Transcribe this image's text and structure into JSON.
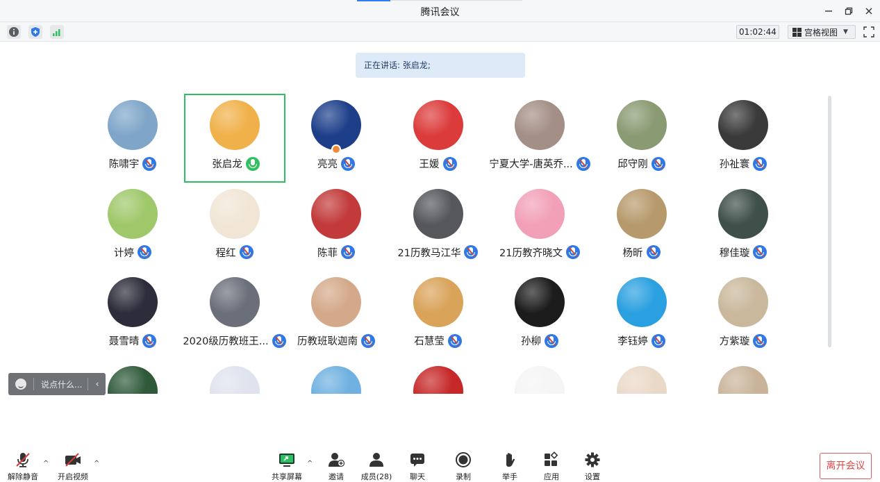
{
  "window": {
    "title": "腾讯会议",
    "icons": [
      "info-icon",
      "shield-icon",
      "signal-icon"
    ],
    "timer": "01:02:44",
    "view_mode": "宫格视图",
    "speaking_banner": "正在讲话: 张启龙;"
  },
  "participants": [
    {
      "name": "陈啸宇",
      "avatar_color": "#7fa6c9",
      "mic": "muted"
    },
    {
      "name": "张启龙",
      "avatar_color": "#f0b14a",
      "mic": "speaking",
      "active": true
    },
    {
      "name": "亮亮",
      "avatar_color": "#1d3f8a",
      "mic": "muted",
      "host": true
    },
    {
      "name": "王媛",
      "avatar_color": "#dc3b3b",
      "mic": "muted"
    },
    {
      "name": "宁夏大学-唐英乔...",
      "avatar_color": "#a48f86",
      "mic": "muted"
    },
    {
      "name": "邱守刚",
      "avatar_color": "#8a9a72",
      "mic": "muted"
    },
    {
      "name": "孙祉寰",
      "avatar_color": "#3a3a3a",
      "mic": "muted"
    },
    {
      "name": "计婷",
      "avatar_color": "#9fc86a",
      "mic": "muted"
    },
    {
      "name": "程红",
      "avatar_color": "#f1e6d6",
      "mic": "muted"
    },
    {
      "name": "陈菲",
      "avatar_color": "#c23a3a",
      "mic": "muted"
    },
    {
      "name": "21历教马江华",
      "avatar_color": "#55575c",
      "mic": "muted"
    },
    {
      "name": "21历教齐晓文",
      "avatar_color": "#f2a0b8",
      "mic": "muted"
    },
    {
      "name": "杨昕",
      "avatar_color": "#b79a6c",
      "mic": "muted"
    },
    {
      "name": "穆佳璇",
      "avatar_color": "#3f4f4a",
      "mic": "muted"
    },
    {
      "name": "聂雪晴",
      "avatar_color": "#2c2c3a",
      "mic": "muted"
    },
    {
      "name": "2020级历教班王...",
      "avatar_color": "#6b6f7a",
      "mic": "muted"
    },
    {
      "name": "历教班耿迦南",
      "avatar_color": "#d4a98a",
      "mic": "muted"
    },
    {
      "name": "石慧莹",
      "avatar_color": "#d9a35a",
      "mic": "muted"
    },
    {
      "name": "孙柳",
      "avatar_color": "#1c1c1c",
      "mic": "muted"
    },
    {
      "name": "李钰婷",
      "avatar_color": "#2aa0e0",
      "mic": "muted"
    },
    {
      "name": "方紫璇",
      "avatar_color": "#c9b89c",
      "mic": "muted"
    },
    {
      "name": "",
      "avatar_color": "#2f5a3a"
    },
    {
      "name": "",
      "avatar_color": "#dfe3ee"
    },
    {
      "name": "",
      "avatar_color": "#6fb1e0"
    },
    {
      "name": "",
      "avatar_color": "#c62828"
    },
    {
      "name": "",
      "avatar_color": "#f5f5f5"
    },
    {
      "name": "",
      "avatar_color": "#ead9c8"
    },
    {
      "name": "",
      "avatar_color": "#c9b49a"
    }
  ],
  "chat": {
    "placeholder": "说点什么..."
  },
  "bottom": {
    "unmute": "解除静音",
    "start_video": "开启视频",
    "share_screen": "共享屏幕",
    "invite": "邀请",
    "members": "成员(28)",
    "chat": "聊天",
    "record": "录制",
    "raise_hand": "举手",
    "apps": "应用",
    "settings": "设置",
    "leave": "离开会议"
  }
}
